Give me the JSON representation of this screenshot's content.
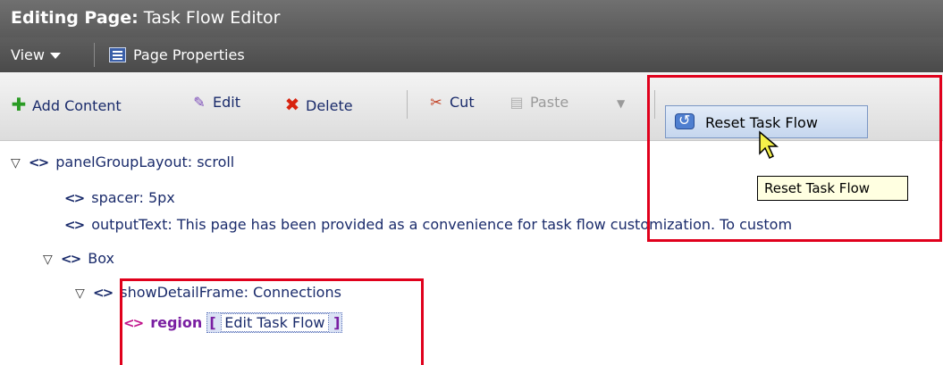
{
  "title": {
    "bold": "Editing Page:",
    "rest": " Task Flow Editor"
  },
  "menubar": {
    "view_label": "View",
    "page_properties_label": "Page Properties"
  },
  "toolbar": {
    "add_content": "Add Content",
    "edit": "Edit",
    "delete": "Delete",
    "cut": "Cut",
    "paste": "Paste",
    "reset_task_flow": "Reset Task Flow"
  },
  "tooltip": "Reset Task Flow",
  "tree": {
    "panel_group_layout": "panelGroupLayout: scroll",
    "spacer": "spacer: 5px",
    "output_text": "outputText: This page has been provided as a convenience for task flow customization. To custom",
    "box": "Box",
    "show_detail_frame": "showDetailFrame: Connections",
    "region": "region",
    "region_open_bracket": "[",
    "edit_task_flow": "Edit Task Flow",
    "region_close_bracket": "]"
  },
  "colors": {
    "highlight": "#e0001c",
    "title_bg": "#636363"
  }
}
